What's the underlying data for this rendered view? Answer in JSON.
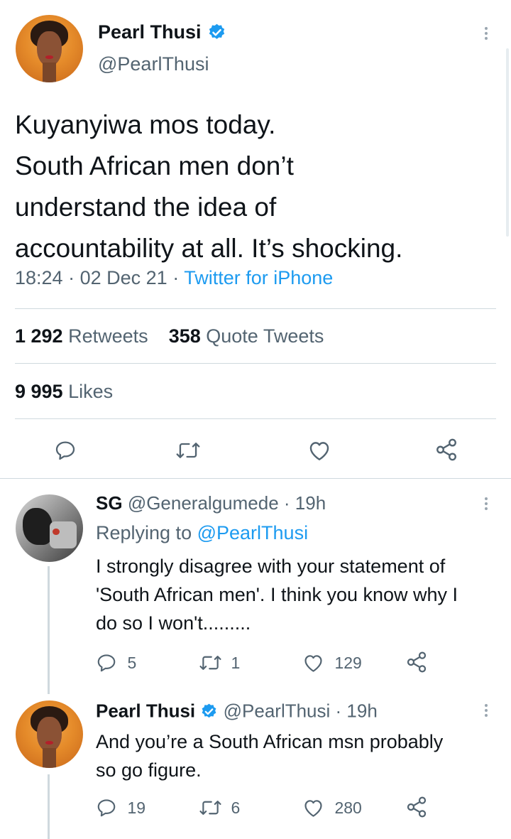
{
  "main_tweet": {
    "author_name": "Pearl Thusi",
    "handle": "@PearlThusi",
    "text_lines": [
      "Kuyanyiwa mos today.",
      "South African men don’t",
      "understand the idea of",
      "accountability at all. It’s shocking."
    ],
    "time": "18:24",
    "date": "02 Dec 21",
    "source": "Twitter for iPhone",
    "retweets_count": "1 292",
    "retweets_label": "Retweets",
    "quotes_count": "358",
    "quotes_label": "Quote Tweets",
    "likes_count": "9 995",
    "likes_label": "Likes"
  },
  "replies": [
    {
      "author_name": "SG",
      "handle": "@Generalgumede",
      "age": "· 19h",
      "replying_prefix": "Replying to",
      "replying_to": "@PearlThusi",
      "text_lines": [
        "I strongly disagree with your statement of",
        "'South African men'. I think you know why I",
        "do so I won't........."
      ],
      "reply_count": "5",
      "retweet_count": "1",
      "like_count": "129"
    },
    {
      "author_name": "Pearl Thusi",
      "handle": "@PearlThusi",
      "age": "· 19h",
      "text_lines": [
        "And you’re a South African msn probably",
        "so go figure."
      ],
      "reply_count": "19",
      "retweet_count": "6",
      "like_count": "280"
    }
  ],
  "colors": {
    "accent": "#1d9bf0",
    "text": "#0f1419",
    "muted": "#536471",
    "divider": "#cfd9de"
  }
}
